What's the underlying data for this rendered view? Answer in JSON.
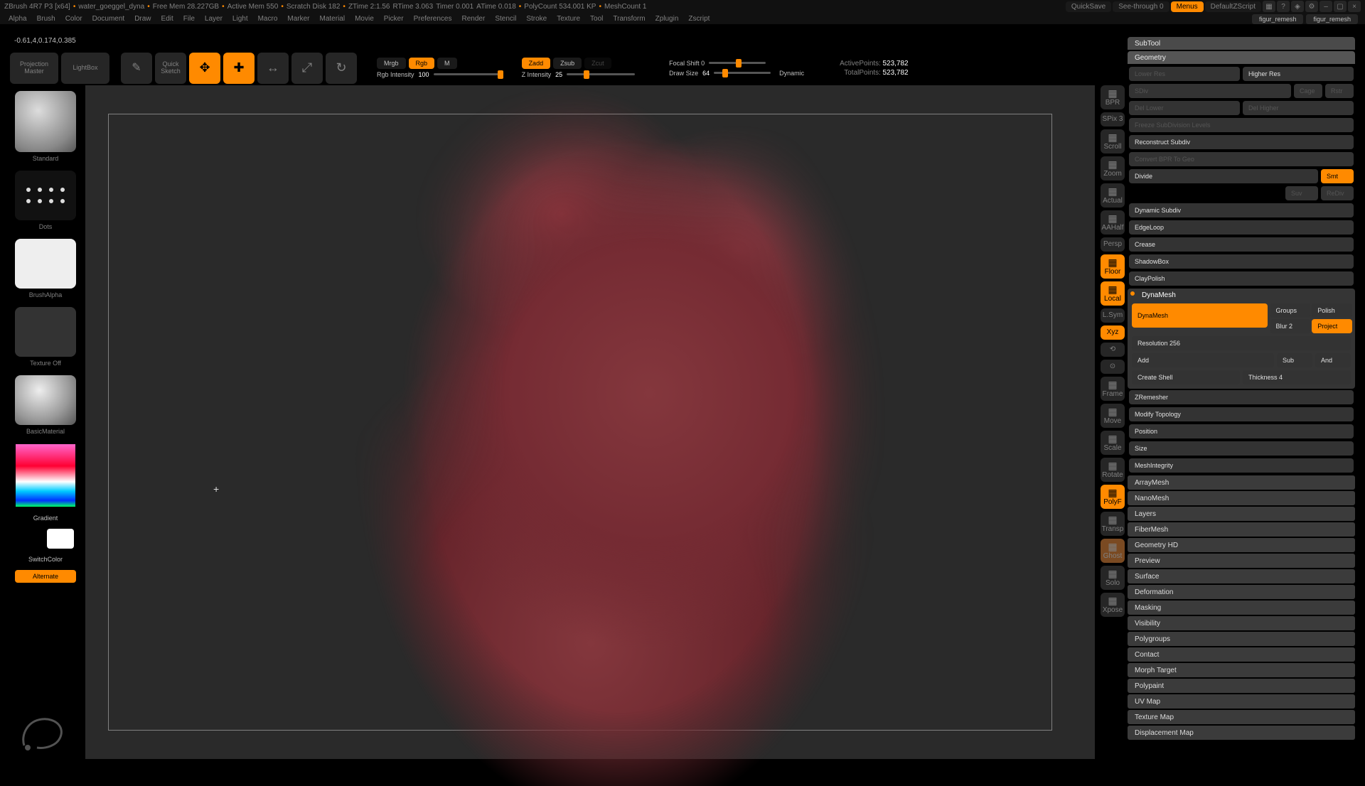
{
  "titlebar": {
    "app": "ZBrush 4R7 P3 [x64]",
    "doc": "water_goeggel_dyna",
    "freeMem": "Free Mem 28.227GB",
    "activeMem": "Active Mem 550",
    "scratch": "Scratch Disk 182",
    "ztime": "ZTime 2:1.56",
    "rtime": "RTime 3.063",
    "timer": "Timer 0.001",
    "atime": "ATime 0.018",
    "polyCount": "PolyCount 534.001 KP",
    "meshCount": "MeshCount 1",
    "quickSave": "QuickSave",
    "seeThrough": "See-through   0",
    "menus": "Menus",
    "defaultZScript": "DefaultZScript"
  },
  "menu": [
    "Alpha",
    "Brush",
    "Color",
    "Document",
    "Draw",
    "Edit",
    "File",
    "Layer",
    "Light",
    "Macro",
    "Marker",
    "Material",
    "Movie",
    "Picker",
    "Preferences",
    "Render",
    "Stencil",
    "Stroke",
    "Texture",
    "Tool",
    "Transform",
    "Zplugin",
    "Zscript"
  ],
  "top_tabs": [
    "figur_remesh",
    "figur_remesh"
  ],
  "coord_readout": "-0.61,4,0.174,0.385",
  "shelf": {
    "projection": "Projection\nMaster",
    "lightbox": "LightBox",
    "quickSketch": "Quick\nSketch",
    "edit": "Edit",
    "draw": "Draw",
    "move": "Move",
    "scale": "Scale",
    "rotate": "Rotate",
    "mrgb": "Mrgb",
    "rgb": "Rgb",
    "m": "M",
    "rgbIntensityLabel": "Rgb Intensity",
    "rgbIntensityVal": "100",
    "zadd": "Zadd",
    "zsub": "Zsub",
    "zcut": "Zcut",
    "zIntensityLabel": "Z Intensity",
    "zIntensityVal": "25",
    "focalShift": "Focal Shift 0",
    "drawSizeLabel": "Draw Size",
    "drawSizeVal": "64",
    "dynamic": "Dynamic",
    "activePointsLabel": "ActivePoints:",
    "activePointsVal": "523,782",
    "totalPointsLabel": "TotalPoints:",
    "totalPointsVal": "523,782"
  },
  "left": {
    "brushName": "Standard",
    "strokeName": "Dots",
    "brushAlpha": "BrushAlpha",
    "textureOff": "Texture Off",
    "material": "BasicMaterial",
    "gradient": "Gradient",
    "switchColor": "SwitchColor",
    "alternate": "Alternate"
  },
  "rail": [
    {
      "label": "BPR",
      "active": false
    },
    {
      "label": "SPix 3",
      "active": false,
      "small": true
    },
    {
      "label": "Scroll",
      "active": false
    },
    {
      "label": "Zoom",
      "active": false
    },
    {
      "label": "Actual",
      "active": false
    },
    {
      "label": "AAHalf",
      "active": false
    },
    {
      "label": "Persp",
      "active": false,
      "small": true
    },
    {
      "label": "Floor",
      "active": true
    },
    {
      "label": "Local",
      "active": true
    },
    {
      "label": "L.Sym",
      "active": false,
      "small": true
    },
    {
      "label": "Xyz",
      "active": true,
      "small": true
    },
    {
      "label": "⟲",
      "active": false,
      "small": true
    },
    {
      "label": "⊙",
      "active": false,
      "small": true
    },
    {
      "label": "Frame",
      "active": false
    },
    {
      "label": "Move",
      "active": false
    },
    {
      "label": "Scale",
      "active": false
    },
    {
      "label": "Rotate",
      "active": false
    },
    {
      "label": "PolyF",
      "active": true
    },
    {
      "label": "Transp",
      "active": false
    },
    {
      "label": "Ghost",
      "active": false,
      "brownish": true
    },
    {
      "label": "Solo",
      "active": false
    },
    {
      "label": "Xpose",
      "active": false
    }
  ],
  "geometry": {
    "title": "Geometry",
    "subtool": "SubTool",
    "lowerRes": "Lower Res",
    "higherRes": "Higher Res",
    "sdiv": "SDiv",
    "cage": "Cage",
    "rstr": "Rstr",
    "delLower": "Del Lower",
    "delHigher": "Del Higher",
    "freeze": "Freeze SubDivision Levels",
    "reconstruct": "Reconstruct Subdiv",
    "convertBPR": "Convert BPR To Geo",
    "divide": "Divide",
    "smt": "Smt",
    "suv": "Suv",
    "rediv": "ReDiv",
    "dynamicSubdiv": "Dynamic Subdiv",
    "edgeLoop": "EdgeLoop",
    "crease": "Crease",
    "shadowBox": "ShadowBox",
    "clayPolish": "ClayPolish",
    "dynamesh": "DynaMesh",
    "dmBtn": "DynaMesh",
    "groups": "Groups",
    "polish": "Polish",
    "blur": "Blur 2",
    "project": "Project",
    "resolution": "Resolution 256",
    "add": "Add",
    "sub": "Sub",
    "and": "And",
    "createShell": "Create Shell",
    "thickness": "Thickness 4",
    "zremesher": "ZRemesher",
    "modifyTopo": "Modify Topology",
    "position": "Position",
    "size": "Size",
    "meshIntegrity": "MeshIntegrity"
  },
  "bottom_sections": [
    "ArrayMesh",
    "NanoMesh",
    "Layers",
    "FiberMesh",
    "Geometry HD",
    "Preview",
    "Surface",
    "Deformation",
    "Masking",
    "Visibility",
    "Polygroups",
    "Contact",
    "Morph Target",
    "Polypaint",
    "UV Map",
    "Texture Map",
    "Displacement Map"
  ]
}
